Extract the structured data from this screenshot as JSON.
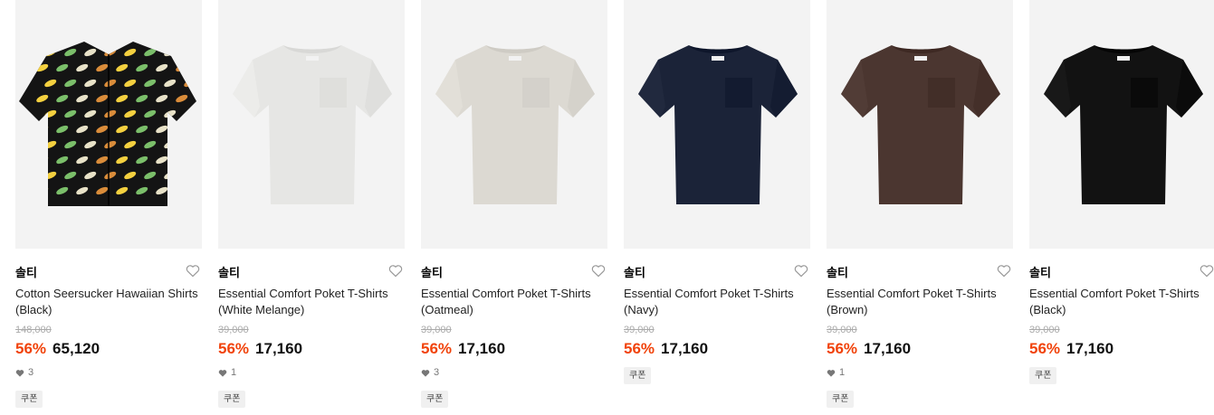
{
  "products": [
    {
      "brand": "솔티",
      "name": "Cotton Seersucker Hawaiian Shirts (Black)",
      "original_price": "148,000",
      "discount": "56%",
      "price": "65,120",
      "likes": "3",
      "coupon": "쿠폰",
      "kind": "hawaiian",
      "color": "#141414"
    },
    {
      "brand": "솔티",
      "name": "Essential Comfort Poket T-Shirts (White Melange)",
      "original_price": "39,000",
      "discount": "56%",
      "price": "17,160",
      "likes": "1",
      "coupon": "쿠폰",
      "kind": "tee",
      "color": "#e6e6e4"
    },
    {
      "brand": "솔티",
      "name": "Essential Comfort Poket T-Shirts (Oatmeal)",
      "original_price": "39,000",
      "discount": "56%",
      "price": "17,160",
      "likes": "3",
      "coupon": "쿠폰",
      "kind": "tee",
      "color": "#dcd9d2"
    },
    {
      "brand": "솔티",
      "name": "Essential Comfort Poket T-Shirts (Navy)",
      "original_price": "39,000",
      "discount": "56%",
      "price": "17,160",
      "likes": null,
      "coupon": "쿠폰",
      "kind": "tee",
      "color": "#1b2338"
    },
    {
      "brand": "솔티",
      "name": "Essential Comfort Poket T-Shirts (Brown)",
      "original_price": "39,000",
      "discount": "56%",
      "price": "17,160",
      "likes": "1",
      "coupon": "쿠폰",
      "kind": "tee",
      "color": "#4b3630"
    },
    {
      "brand": "솔티",
      "name": "Essential Comfort Poket T-Shirts (Black)",
      "original_price": "39,000",
      "discount": "56%",
      "price": "17,160",
      "likes": null,
      "coupon": "쿠폰",
      "kind": "tee",
      "color": "#121212"
    }
  ],
  "icons": {
    "wishlist": "heart-outline-icon",
    "likes": "heart-filled-icon"
  },
  "colors": {
    "discount": "#f1430b",
    "thumb_bg": "#f3f3f3"
  }
}
